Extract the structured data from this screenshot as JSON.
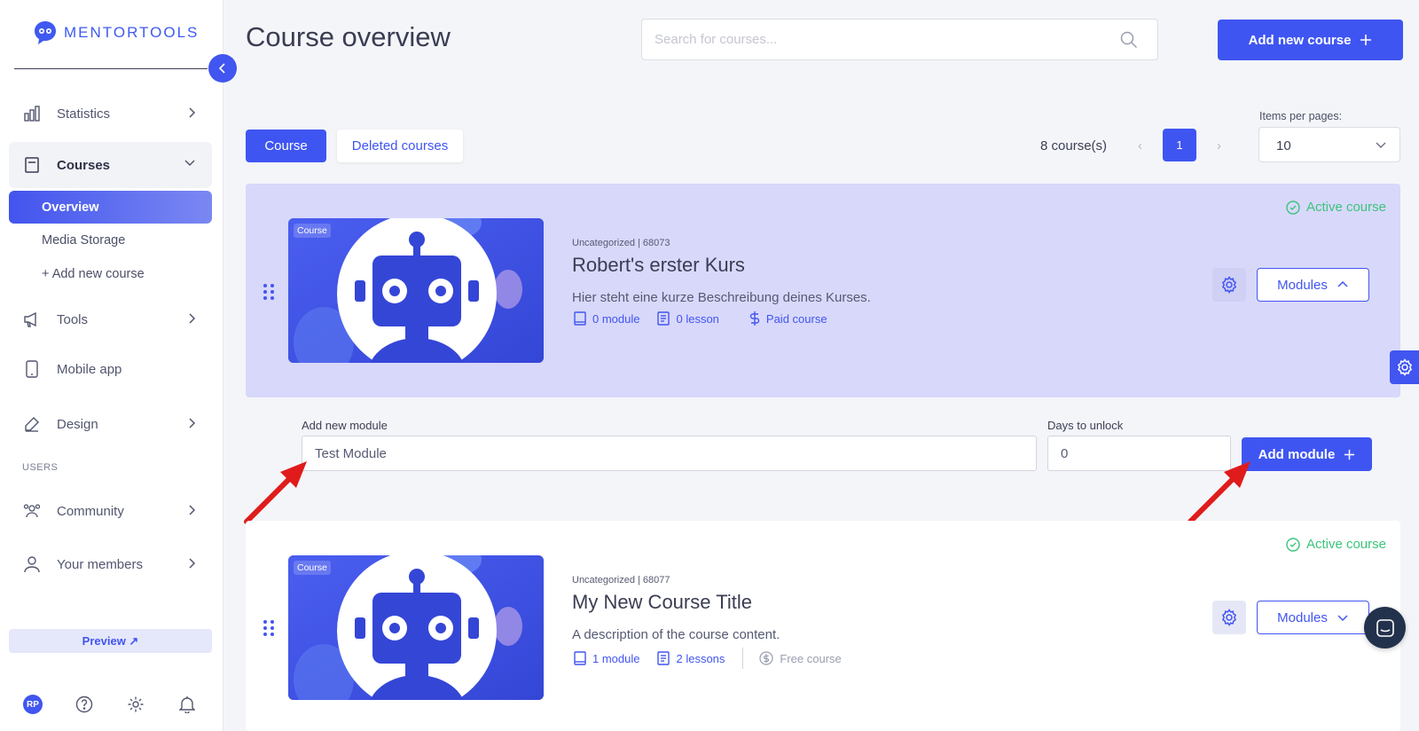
{
  "app": {
    "brand": "MENTORTOOLS"
  },
  "sidebar": {
    "items": [
      {
        "label": "Statistics",
        "icon": "bar-chart-icon"
      },
      {
        "label": "Courses",
        "icon": "book-icon"
      },
      {
        "label": "Tools",
        "icon": "megaphone-icon"
      },
      {
        "label": "Mobile app",
        "icon": "phone-icon"
      },
      {
        "label": "Design",
        "icon": "pencil-icon"
      },
      {
        "label": "Community",
        "icon": "people-icon"
      },
      {
        "label": "Your members",
        "icon": "user-icon"
      }
    ],
    "sub_items": [
      "Overview",
      "Media Storage",
      "+ Add new course"
    ],
    "users_section": "USERS",
    "preview_label": "Preview ↗",
    "avatar_initials": "RP"
  },
  "header": {
    "title": "Course overview",
    "search_placeholder": "Search for courses...",
    "add_course_label": "Add new course"
  },
  "toolbar": {
    "tab_course": "Course",
    "tab_deleted": "Deleted courses",
    "course_count": "8 course(s)",
    "current_page": "1",
    "items_per_page_label": "Items per pages:",
    "items_per_page_value": "10"
  },
  "courses": [
    {
      "tag": "Course",
      "meta": "Uncategorized | 68073",
      "title": "Robert's erster Kurs",
      "description": "Hier steht eine kurze Beschreibung deines Kurses.",
      "modules": "0 module",
      "lessons": "0 lesson",
      "pricing": "Paid course",
      "status": "Active course",
      "modules_button": "Modules"
    },
    {
      "tag": "Course",
      "meta": "Uncategorized | 68077",
      "title": "My New Course Title",
      "description": "A description of the course content.",
      "modules": "1 module",
      "lessons": "2 lessons",
      "pricing": "Free course",
      "status": "Active course",
      "modules_button": "Modules"
    }
  ],
  "add_module_form": {
    "name_label": "Add new module",
    "name_value": "Test Module",
    "days_label": "Days to unlock",
    "days_value": "0",
    "submit_label": "Add module"
  },
  "colors": {
    "accent": "#3f55f2",
    "active_green": "#3cc47c",
    "card_highlight": "#d8d8fb",
    "annotation_arrow": "#e01b1b"
  }
}
